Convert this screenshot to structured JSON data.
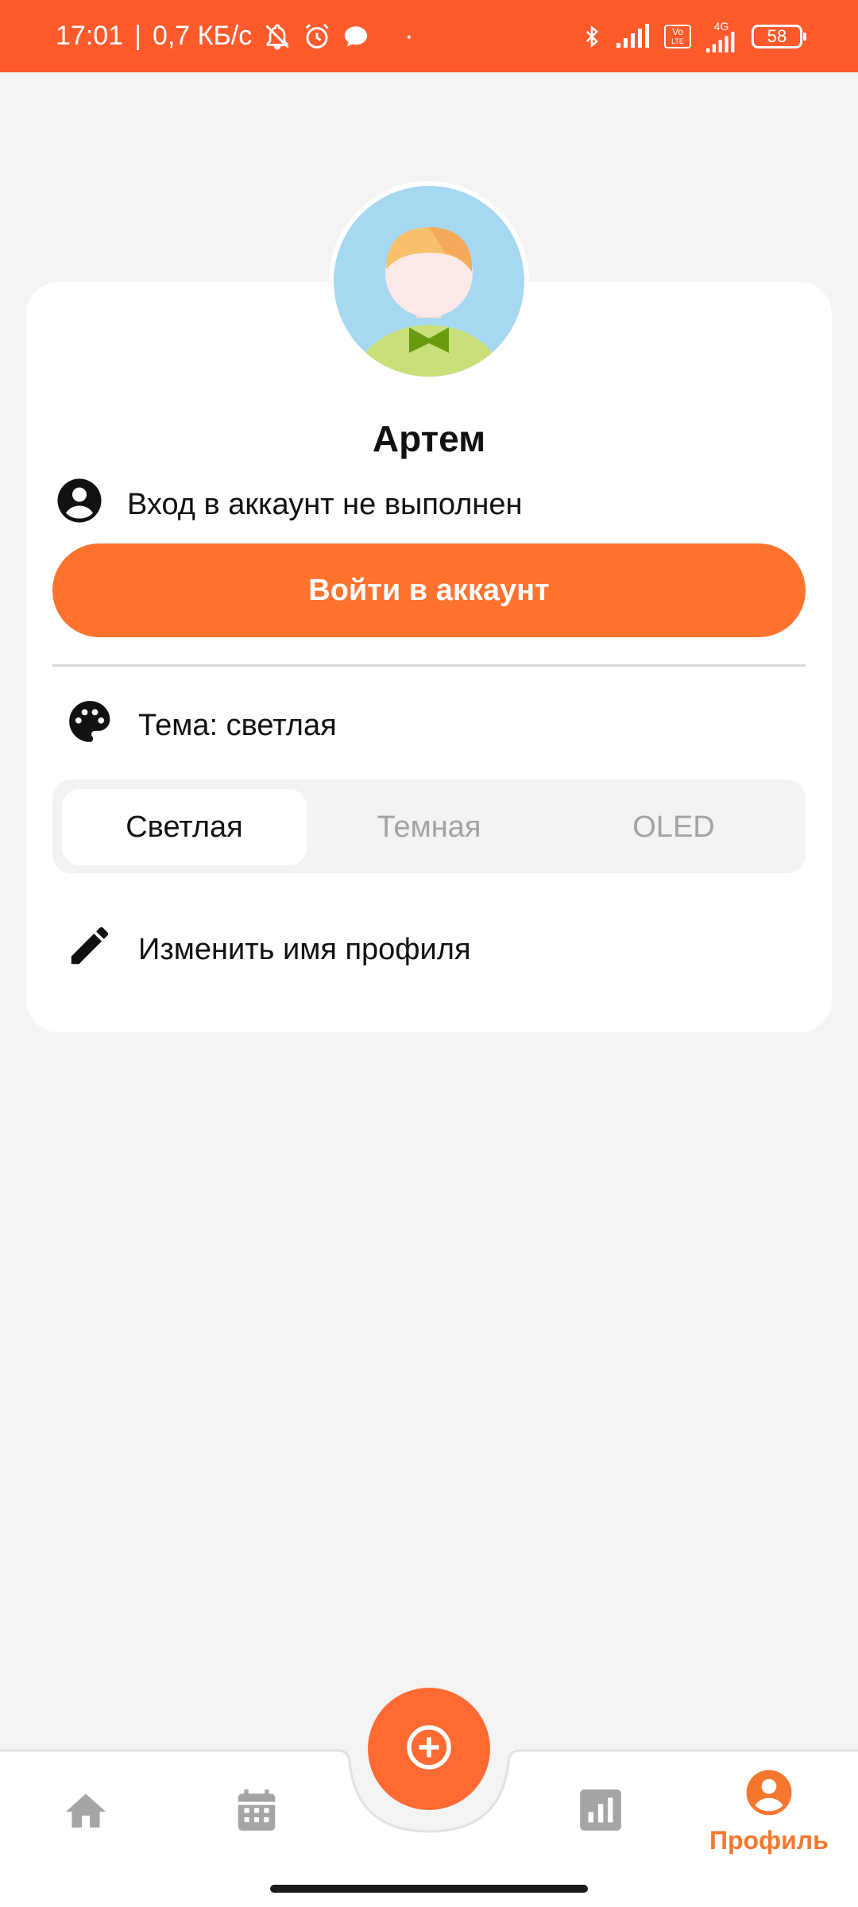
{
  "status_bar": {
    "time": "17:01",
    "network_speed": "0,7 КБ/с",
    "dot": "·",
    "volte_top": "Vo",
    "volte_bottom": "LTE",
    "network_type": "4G",
    "battery": "58"
  },
  "profile": {
    "name": "Артем",
    "login_status": "Вход в аккаунт не выполнен",
    "login_button": "Войти в аккаунт"
  },
  "theme": {
    "label": "Тема: светлая",
    "options": [
      "Светлая",
      "Темная",
      "OLED"
    ],
    "selected": "Светлая"
  },
  "edit_name": {
    "label": "Изменить имя профиля"
  },
  "bottom_nav": {
    "items": [
      "home-icon",
      "calendar-icon",
      "add-circle-icon",
      "stats-icon",
      "profile-icon"
    ],
    "profile_label": "Профиль",
    "active": "profile"
  },
  "colors": {
    "accent": "#ff732e",
    "status_bar": "#ff5a2c",
    "active_nav": "#f5772e",
    "inactive_icon": "#a5a5a5"
  }
}
